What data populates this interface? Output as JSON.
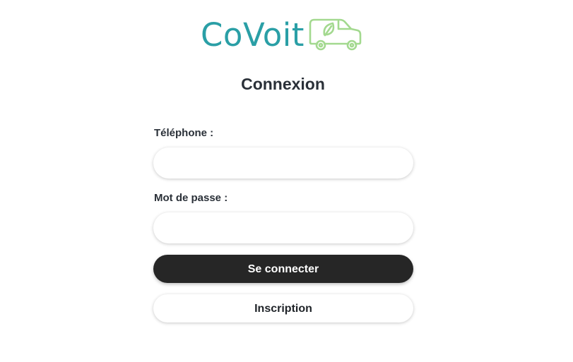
{
  "brand": {
    "name": "CoVoit",
    "text_color": "#2a9fa6",
    "icon": "car-leaf-icon",
    "icon_color": "#a3d98f"
  },
  "page": {
    "title": "Connexion"
  },
  "form": {
    "phone_label": "Téléphone :",
    "phone_value": "",
    "password_label": "Mot de passe :",
    "password_value": "",
    "login_button": "Se connecter",
    "register_button": "Inscription"
  },
  "colors": {
    "primary_button": "#262626",
    "text": "#2a3038"
  }
}
